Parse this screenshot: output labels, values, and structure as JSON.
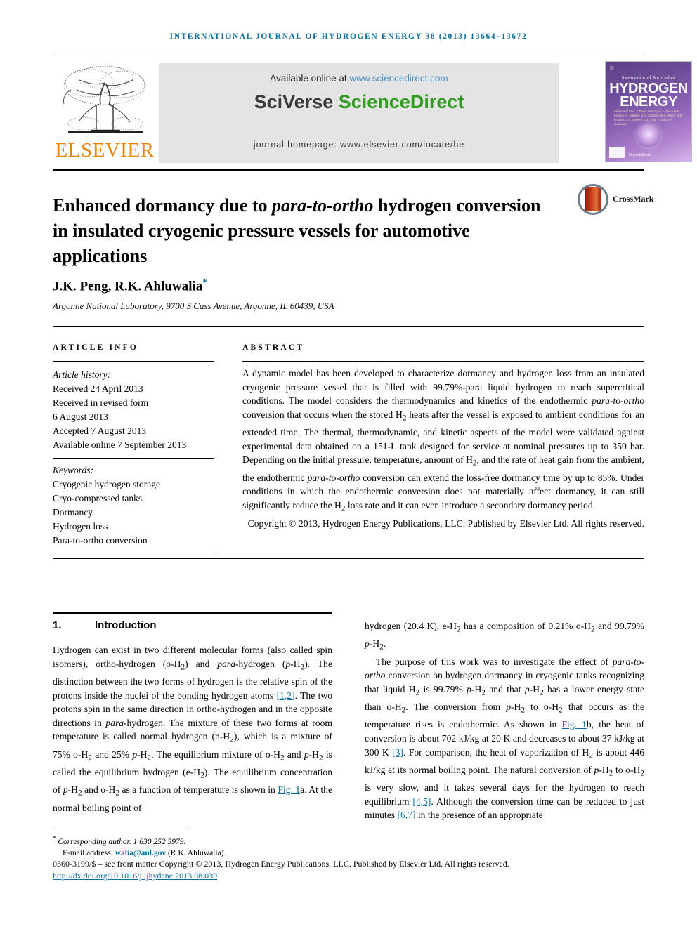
{
  "running_head": "International Journal of Hydrogen Energy 38 (2013) 13664–13672",
  "masthead": {
    "publisher_name": "ELSEVIER",
    "publisher_logo": "elsevier-tree-logo",
    "available_prefix": "Available online at ",
    "available_url": "www.sciencedirect.com",
    "sciverse_prefix": "SciVerse ",
    "sciverse_suffix": "ScienceDirect",
    "homepage": "journal homepage: www.elsevier.com/locate/he",
    "cover": {
      "top_small": "International Journal of",
      "line1": "HYDROGEN",
      "line2": "ENERGY",
      "editors": "Editor-in-Chief: T. Nejat Veziroglu — Associate Editors: A. Bartels, E.C. Gordon, M.A. Nazri, R.Z. Pourke, J.P. Shelley, L.u. Ting, T. and D.Y. Goswami",
      "brand": "ScienceDirect"
    }
  },
  "article": {
    "title_line1_a": "Enhanced dormancy due to ",
    "title_line1_em": "para-to-ortho",
    "title_line1_b": " hydrogen",
    "title_line2": "conversion in insulated cryogenic pressure vessels",
    "title_line3": "for automotive applications",
    "crossmark_label": "CrossMark",
    "authors": "J.K. Peng, R.K. Ahluwalia",
    "corresponding_marker": "*",
    "affiliation": "Argonne National Laboratory, 9700 S Cass Avenue, Argonne, IL 60439, USA"
  },
  "article_info": {
    "heading": "ARTICLE INFO",
    "history_label": "Article history:",
    "history": [
      "Received 24 April 2013",
      "Received in revised form",
      "6 August 2013",
      "Accepted 7 August 2013",
      "Available online 7 September 2013"
    ],
    "keywords_label": "Keywords:",
    "keywords": [
      "Cryogenic hydrogen storage",
      "Cryo-compressed tanks",
      "Dormancy",
      "Hydrogen loss",
      "Para-to-ortho conversion"
    ]
  },
  "abstract": {
    "heading": "ABSTRACT",
    "p1_a": "A dynamic model has been developed to characterize dormancy and hydrogen loss from an insulated cryogenic pressure vessel that is filled with 99.79%-para liquid hydrogen to reach supercritical conditions. The model considers the thermodynamics and kinetics of the endothermic ",
    "p1_em1": "para-to-ortho",
    "p1_b": " conversion that occurs when the stored H",
    "p1_sub1": "2",
    "p1_c": " heats after the vessel is exposed to ambient conditions for an extended time. The thermal, thermodynamic, and kinetic aspects of the model were validated against experimental data obtained on a 151-L tank designed for service at nominal pressures up to 350 bar. Depending on the initial pressure, temperature, amount of H",
    "p1_sub2": "2",
    "p1_d": ", and the rate of heat gain from the ambient, the endothermic ",
    "p1_em2": "para-to-ortho",
    "p1_e": " conversion can extend the loss-free dormancy time by up to 85%. Under conditions in which the endothermic conversion does not materially affect dormancy, it can still significantly reduce the H",
    "p1_sub3": "2",
    "p1_f": " loss rate and it can even introduce a secondary dormancy period.",
    "copyright": "Copyright © 2013, Hydrogen Energy Publications, LLC. Published by Elsevier Ltd. All rights reserved."
  },
  "section": {
    "number": "1.",
    "title": "Introduction"
  },
  "body": {
    "left_p1": [
      "Hydrogen can exist in two different molecular forms (also called spin isomers), ortho-hydrogen (o-H",
      "2",
      ") and ",
      "para",
      "-hydrogen (",
      "p",
      "-H",
      "2",
      "). The distinction between the two forms of hydrogen is the relative spin of the protons inside the nuclei of the bonding hydrogen atoms ",
      "[1,2]",
      ". The two protons spin in the same direction in ortho-hydrogen and in the opposite directions in ",
      "para",
      "-hydrogen. The mixture of these two forms at room temperature is called normal hydrogen (n-H",
      "2",
      "), which is a mixture of 75% o-H",
      "2",
      " and 25% ",
      "p",
      "-H",
      "2",
      ". The equilibrium mixture of o-H",
      "2",
      " and ",
      "p",
      "-H",
      "2",
      " is called the equilibrium hydrogen (e-H",
      "2",
      "). The equilibrium concentration of ",
      "p",
      "-H",
      "2",
      " and o-H",
      "2",
      " as a function of temperature is shown in ",
      "Fig. 1",
      "a. At the normal boiling point of"
    ],
    "right_p1_a": "hydrogen (20.4 K), e-H",
    "right_p1_sub": "2",
    "right_p1_b": " has a composition of 0.21% o-H",
    "right_p1_sub2": "2",
    "right_p1_c": " and 99.79% ",
    "right_p1_em": "p",
    "right_p1_d": "-H",
    "right_p1_sub3": "2",
    "right_p1_e": ".",
    "right_p2_a": "The purpose of this work was to investigate the effect of ",
    "right_p2_em1": "para-to-ortho",
    "right_p2_b": " conversion on hydrogen dormancy in cryogenic tanks recognizing that liquid H",
    "right_p2_c": " is 99.79% ",
    "right_p2_d": " and that ",
    "right_p2_e": " has a lower energy state than o-H",
    "right_p2_f": ". The conversion from ",
    "right_p2_g": " to o-H",
    "right_p2_h": " that occurs as the temperature rises is endothermic. As shown in ",
    "right_p2_figlink": "Fig. 1",
    "right_p2_i": "b, the heat of conversion is about 702 kJ/kg at 20 K and decreases to about 37 kJ/kg at 300 K ",
    "right_p2_ref1": "[3]",
    "right_p2_j": ". For comparison, the heat of vaporization of H",
    "right_p2_k": " is about 446 kJ/kg at its normal boiling point. The natural conversion of ",
    "right_p2_l": " to o-H",
    "right_p2_m": " is very slow, and it takes several days for the hydrogen to reach equilibrium ",
    "right_p2_ref2": "[4,5]",
    "right_p2_n": ". Although the conversion time can be reduced to just minutes ",
    "right_p2_ref3": "[6,7]",
    "right_p2_o": " in the presence of an appropriate"
  },
  "footnote": {
    "star": "*",
    "corresponding": "Corresponding author. 1 630 252 5979.",
    "email_label": "E-mail address: ",
    "email": "walia@anl.gov",
    "email_suffix": " (R.K. Ahluwalia)."
  },
  "footer": {
    "issn_line": "0360-3199/$ – see front matter Copyright © 2013, Hydrogen Energy Publications, LLC. Published by Elsevier Ltd. All rights reserved.",
    "doi": "http://dx.doi.org/10.1016/j.ijhydene.2013.08.039"
  },
  "colors": {
    "link": "#0b6f9e",
    "elsevier_orange": "#ef8200",
    "sciencedirect_green": "#2f9c1f",
    "band_gray": "#e4e4e4"
  }
}
